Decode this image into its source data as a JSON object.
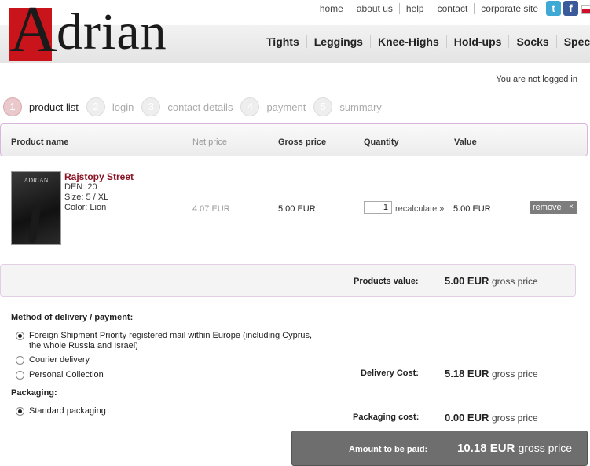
{
  "header": {
    "logo_first": "A",
    "logo_rest": "drian",
    "top_links": [
      "home",
      "about us",
      "help",
      "contact",
      "corporate site"
    ],
    "nav": [
      "Tights",
      "Leggings",
      "Knee-Highs",
      "Hold-ups",
      "Socks",
      "Special"
    ],
    "login_status": "You are not logged in"
  },
  "steps": [
    {
      "num": "1",
      "label": "product list"
    },
    {
      "num": "2",
      "label": "login"
    },
    {
      "num": "3",
      "label": "contact details"
    },
    {
      "num": "4",
      "label": "payment"
    },
    {
      "num": "5",
      "label": "summary"
    }
  ],
  "table": {
    "headers": {
      "product_name": "Product name",
      "net_price": "Net price",
      "gross_price": "Gross price",
      "quantity": "Quantity",
      "value": "Value"
    },
    "item": {
      "thumb_brand": "ADRIAN",
      "name": "Rajstopy Street",
      "den": "DEN: 20",
      "size": "Size: 5 / XL",
      "color": "Color: Lion",
      "net_price": "4.07 EUR",
      "gross_price": "5.00 EUR",
      "quantity": "1",
      "recalculate": "recalculate »",
      "value": "5.00 EUR",
      "remove": "remove",
      "remove_x": "×"
    }
  },
  "summary": {
    "products_label": "Products value:",
    "products_amount": "5.00 EUR",
    "gross_suffix": "gross price",
    "delivery_label": "Delivery Cost:",
    "delivery_amount": "5.18 EUR",
    "packaging_label": "Packaging cost:",
    "packaging_amount": "0.00 EUR",
    "total_label": "Amount to be paid:",
    "total_amount": "10.18 EUR"
  },
  "delivery": {
    "title": "Method of delivery / payment:",
    "options": [
      "Foreign Shipment Priority registered mail within Europe (including Cyprus, the whole Russia and Israel)",
      "Courier delivery",
      "Personal Collection"
    ]
  },
  "packaging": {
    "title": "Packaging:",
    "options": [
      "Standard packaging"
    ]
  }
}
